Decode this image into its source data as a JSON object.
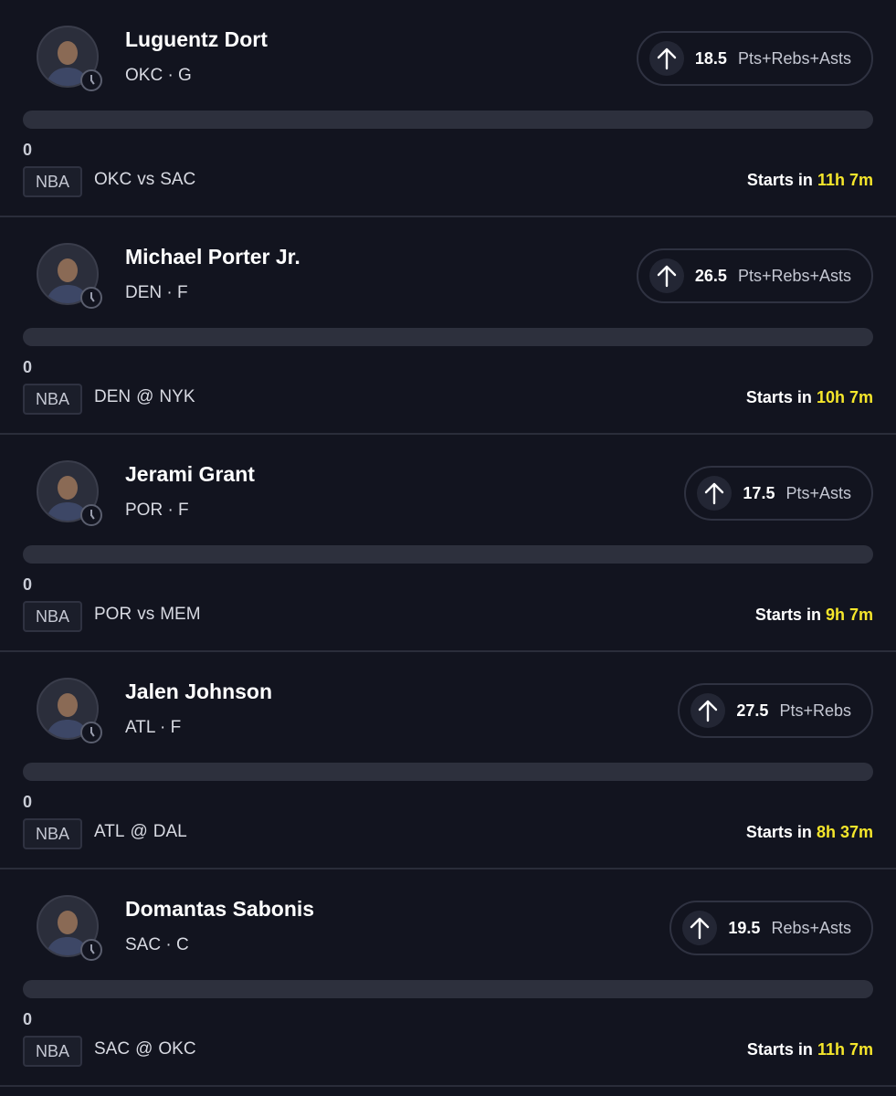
{
  "theme": {
    "background": "#12141f",
    "accent_time": "#f5e62b"
  },
  "icons": {
    "direction": "arrow-up-icon",
    "status": "clock-icon"
  },
  "props": [
    {
      "name": "Luguentz Dort",
      "team": "OKC",
      "position": "G",
      "meta": "OKC · G",
      "line": "18.5",
      "stat": "Pts+Rebs+Asts",
      "progress": "0",
      "league": "NBA",
      "home": "OKC",
      "separator": "vs",
      "opponent": "SAC",
      "starts_label": "Starts in",
      "starts_time": "11h 7m"
    },
    {
      "name": "Michael Porter Jr.",
      "team": "DEN",
      "position": "F",
      "meta": "DEN · F",
      "line": "26.5",
      "stat": "Pts+Rebs+Asts",
      "progress": "0",
      "league": "NBA",
      "home": "DEN",
      "separator": "@",
      "opponent": "NYK",
      "starts_label": "Starts in",
      "starts_time": "10h 7m"
    },
    {
      "name": "Jerami Grant",
      "team": "POR",
      "position": "F",
      "meta": "POR · F",
      "line": "17.5",
      "stat": "Pts+Asts",
      "progress": "0",
      "league": "NBA",
      "home": "POR",
      "separator": "vs",
      "opponent": "MEM",
      "starts_label": "Starts in",
      "starts_time": "9h 7m"
    },
    {
      "name": "Jalen Johnson",
      "team": "ATL",
      "position": "F",
      "meta": "ATL · F",
      "line": "27.5",
      "stat": "Pts+Rebs",
      "progress": "0",
      "league": "NBA",
      "home": "ATL",
      "separator": "@",
      "opponent": "DAL",
      "starts_label": "Starts in",
      "starts_time": "8h 37m"
    },
    {
      "name": "Domantas Sabonis",
      "team": "SAC",
      "position": "C",
      "meta": "SAC · C",
      "line": "19.5",
      "stat": "Rebs+Asts",
      "progress": "0",
      "league": "NBA",
      "home": "SAC",
      "separator": "@",
      "opponent": "OKC",
      "starts_label": "Starts in",
      "starts_time": "11h 7m"
    }
  ]
}
